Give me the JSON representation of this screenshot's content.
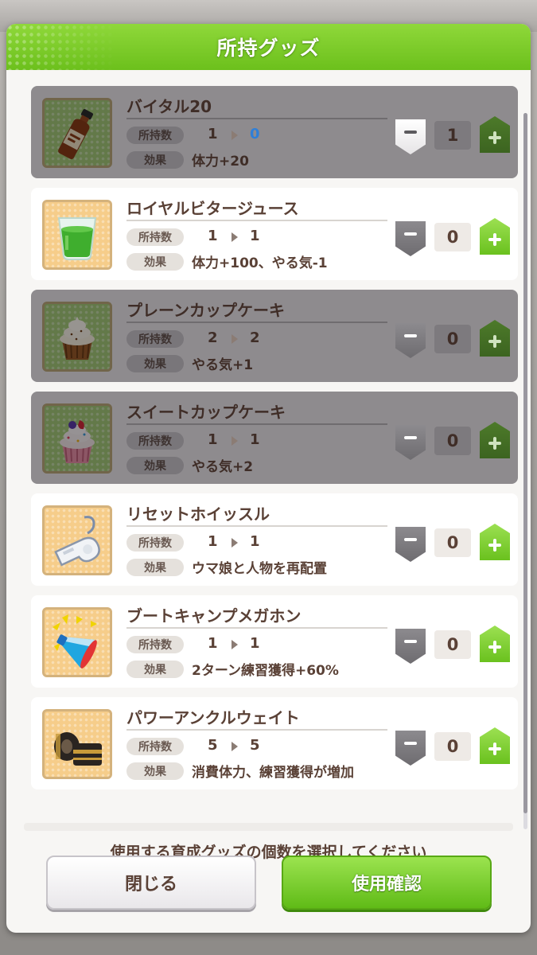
{
  "dialog": {
    "title": "所持グッズ",
    "instruction": "使用する育成グッズの個数を選択してください",
    "close_label": "閉じる",
    "confirm_label": "使用確認"
  },
  "labels": {
    "owned": "所持数",
    "effect": "効果"
  },
  "colors": {
    "header_green": "#7ccc28",
    "confirm_green": "#6cc01c",
    "text_brown": "#5a4136",
    "highlight_blue": "#2f7fd8"
  },
  "items": [
    {
      "name": "バイタル20",
      "owned_from": "1",
      "owned_to": "0",
      "effect": "体力+20",
      "count": "1",
      "icon": "vitamin-bottle-icon",
      "dimmed": true
    },
    {
      "name": "ロイヤルビタージュース",
      "owned_from": "1",
      "owned_to": "1",
      "effect": "体力+100、やる気-1",
      "count": "0",
      "icon": "green-juice-glass-icon",
      "dimmed": false
    },
    {
      "name": "プレーンカップケーキ",
      "owned_from": "2",
      "owned_to": "2",
      "effect": "やる気+1",
      "count": "0",
      "icon": "plain-cupcake-icon",
      "dimmed": true
    },
    {
      "name": "スイートカップケーキ",
      "owned_from": "1",
      "owned_to": "1",
      "effect": "やる気+2",
      "count": "0",
      "icon": "sweet-cupcake-icon",
      "dimmed": true
    },
    {
      "name": "リセットホイッスル",
      "owned_from": "1",
      "owned_to": "1",
      "effect": "ウマ娘と人物を再配置",
      "count": "0",
      "icon": "whistle-icon",
      "dimmed": false
    },
    {
      "name": "ブートキャンプメガホン",
      "owned_from": "1",
      "owned_to": "1",
      "effect": "2ターン練習獲得+60%",
      "count": "0",
      "icon": "megaphone-icon",
      "dimmed": false
    },
    {
      "name": "パワーアンクルウェイト",
      "owned_from": "5",
      "owned_to": "5",
      "effect": "消費体力、練習獲得が増加",
      "count": "0",
      "icon": "ankle-weights-icon",
      "dimmed": false
    }
  ]
}
